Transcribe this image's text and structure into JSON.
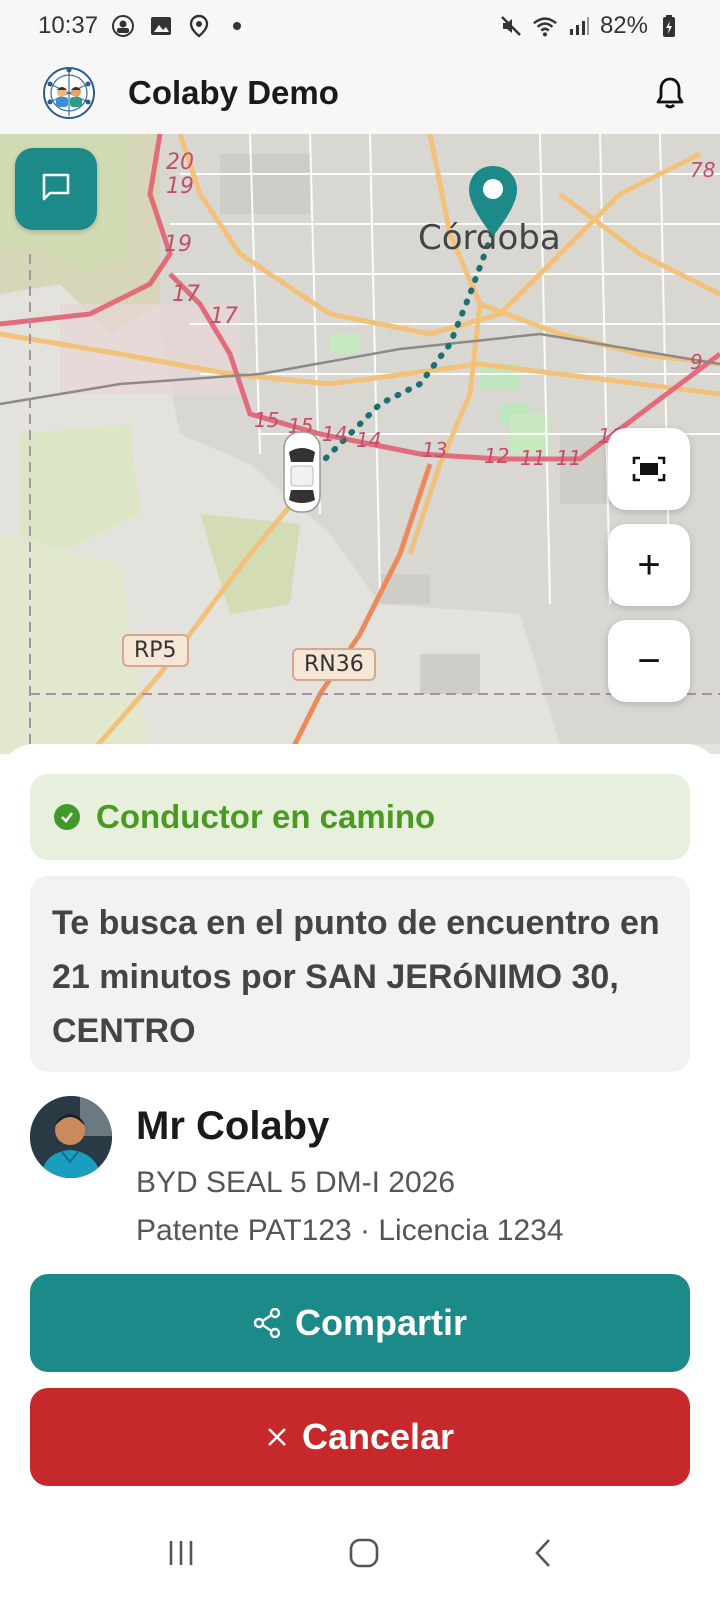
{
  "status_bar": {
    "time": "10:37",
    "battery": "82%",
    "icons": [
      "app-notification-icon",
      "image-icon",
      "location-icon",
      "dot-icon",
      "mute-icon",
      "wifi-icon",
      "signal-icon",
      "battery-icon"
    ]
  },
  "header": {
    "title": "Colaby Demo",
    "logo_icon": "colaby-logo",
    "notification_icon": "bell-icon"
  },
  "map": {
    "city_label": "Córdoba",
    "road_shields": [
      "RP5",
      "RN36"
    ],
    "km_labels": [
      "20",
      "19",
      "19",
      "17",
      "17",
      "15",
      "15",
      "14",
      "14",
      "13",
      "12",
      "11",
      "11",
      "10",
      "9",
      "78"
    ],
    "controls": {
      "chat_icon": "chat-icon",
      "fit_icon": "fit-view-icon",
      "zoom_in": "+",
      "zoom_out": "−"
    },
    "accent_color": "#1d8a8a"
  },
  "trip": {
    "status": "Conductor en camino",
    "status_color": "#4a9a22",
    "pickup_message": "Te busca en el punto de encuentro en 21 minutos por SAN JERóNIMO 30, CENTRO"
  },
  "driver": {
    "name": "Mr Colaby",
    "car": "BYD SEAL 5 DM-I 2026",
    "plate_license": "Patente PAT123 · Licencia 1234"
  },
  "actions": {
    "share_label": "Compartir",
    "share_color": "#1d8a8a",
    "cancel_label": "Cancelar",
    "cancel_color": "#c6282b"
  },
  "navbar": {
    "icons": [
      "recent-apps-icon",
      "home-icon",
      "back-icon"
    ]
  }
}
